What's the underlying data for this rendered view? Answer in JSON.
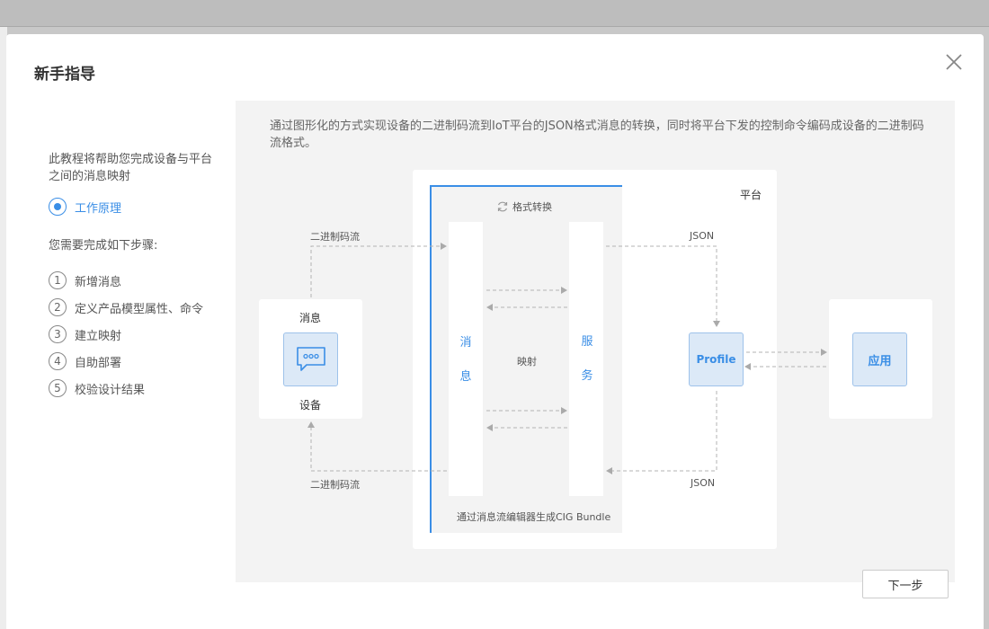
{
  "dialog": {
    "title": "新手指导",
    "intro": "此教程将帮助您完成设备与平台之间的消息映射",
    "current_step": "工作原理",
    "steps_heading": "您需要完成如下步骤:",
    "steps": [
      {
        "num": "1",
        "label": "新增消息"
      },
      {
        "num": "2",
        "label": "定义产品模型属性、命令"
      },
      {
        "num": "3",
        "label": "建立映射"
      },
      {
        "num": "4",
        "label": "自助部署"
      },
      {
        "num": "5",
        "label": "校验设计结果"
      }
    ],
    "next_label": "下一步"
  },
  "diagram": {
    "description": "通过图形化的方式实现设备的二进制码流到IoT平台的JSON格式消息的转换，同时将平台下发的控制命令编码成设备的二进制码流格式。",
    "device_top": "消息",
    "device_bottom": "设备",
    "binary_top": "二进制码流",
    "binary_bottom": "二进制码流",
    "convert": "格式转换",
    "message_v": [
      "消",
      "息"
    ],
    "mapping": "映射",
    "service_v": [
      "服",
      "务"
    ],
    "footer": "通过消息流编辑器生成CIG Bundle",
    "platform": "平台",
    "json_top": "JSON",
    "json_bottom": "JSON",
    "profile": "Profile",
    "app": "应用"
  },
  "colors": {
    "accent": "#3a8ee6",
    "box_fill": "#dce9f7",
    "panel_bg": "#f3f3f3"
  },
  "icons": [
    "close-icon",
    "chat-bubble-icon",
    "refresh-icon"
  ]
}
